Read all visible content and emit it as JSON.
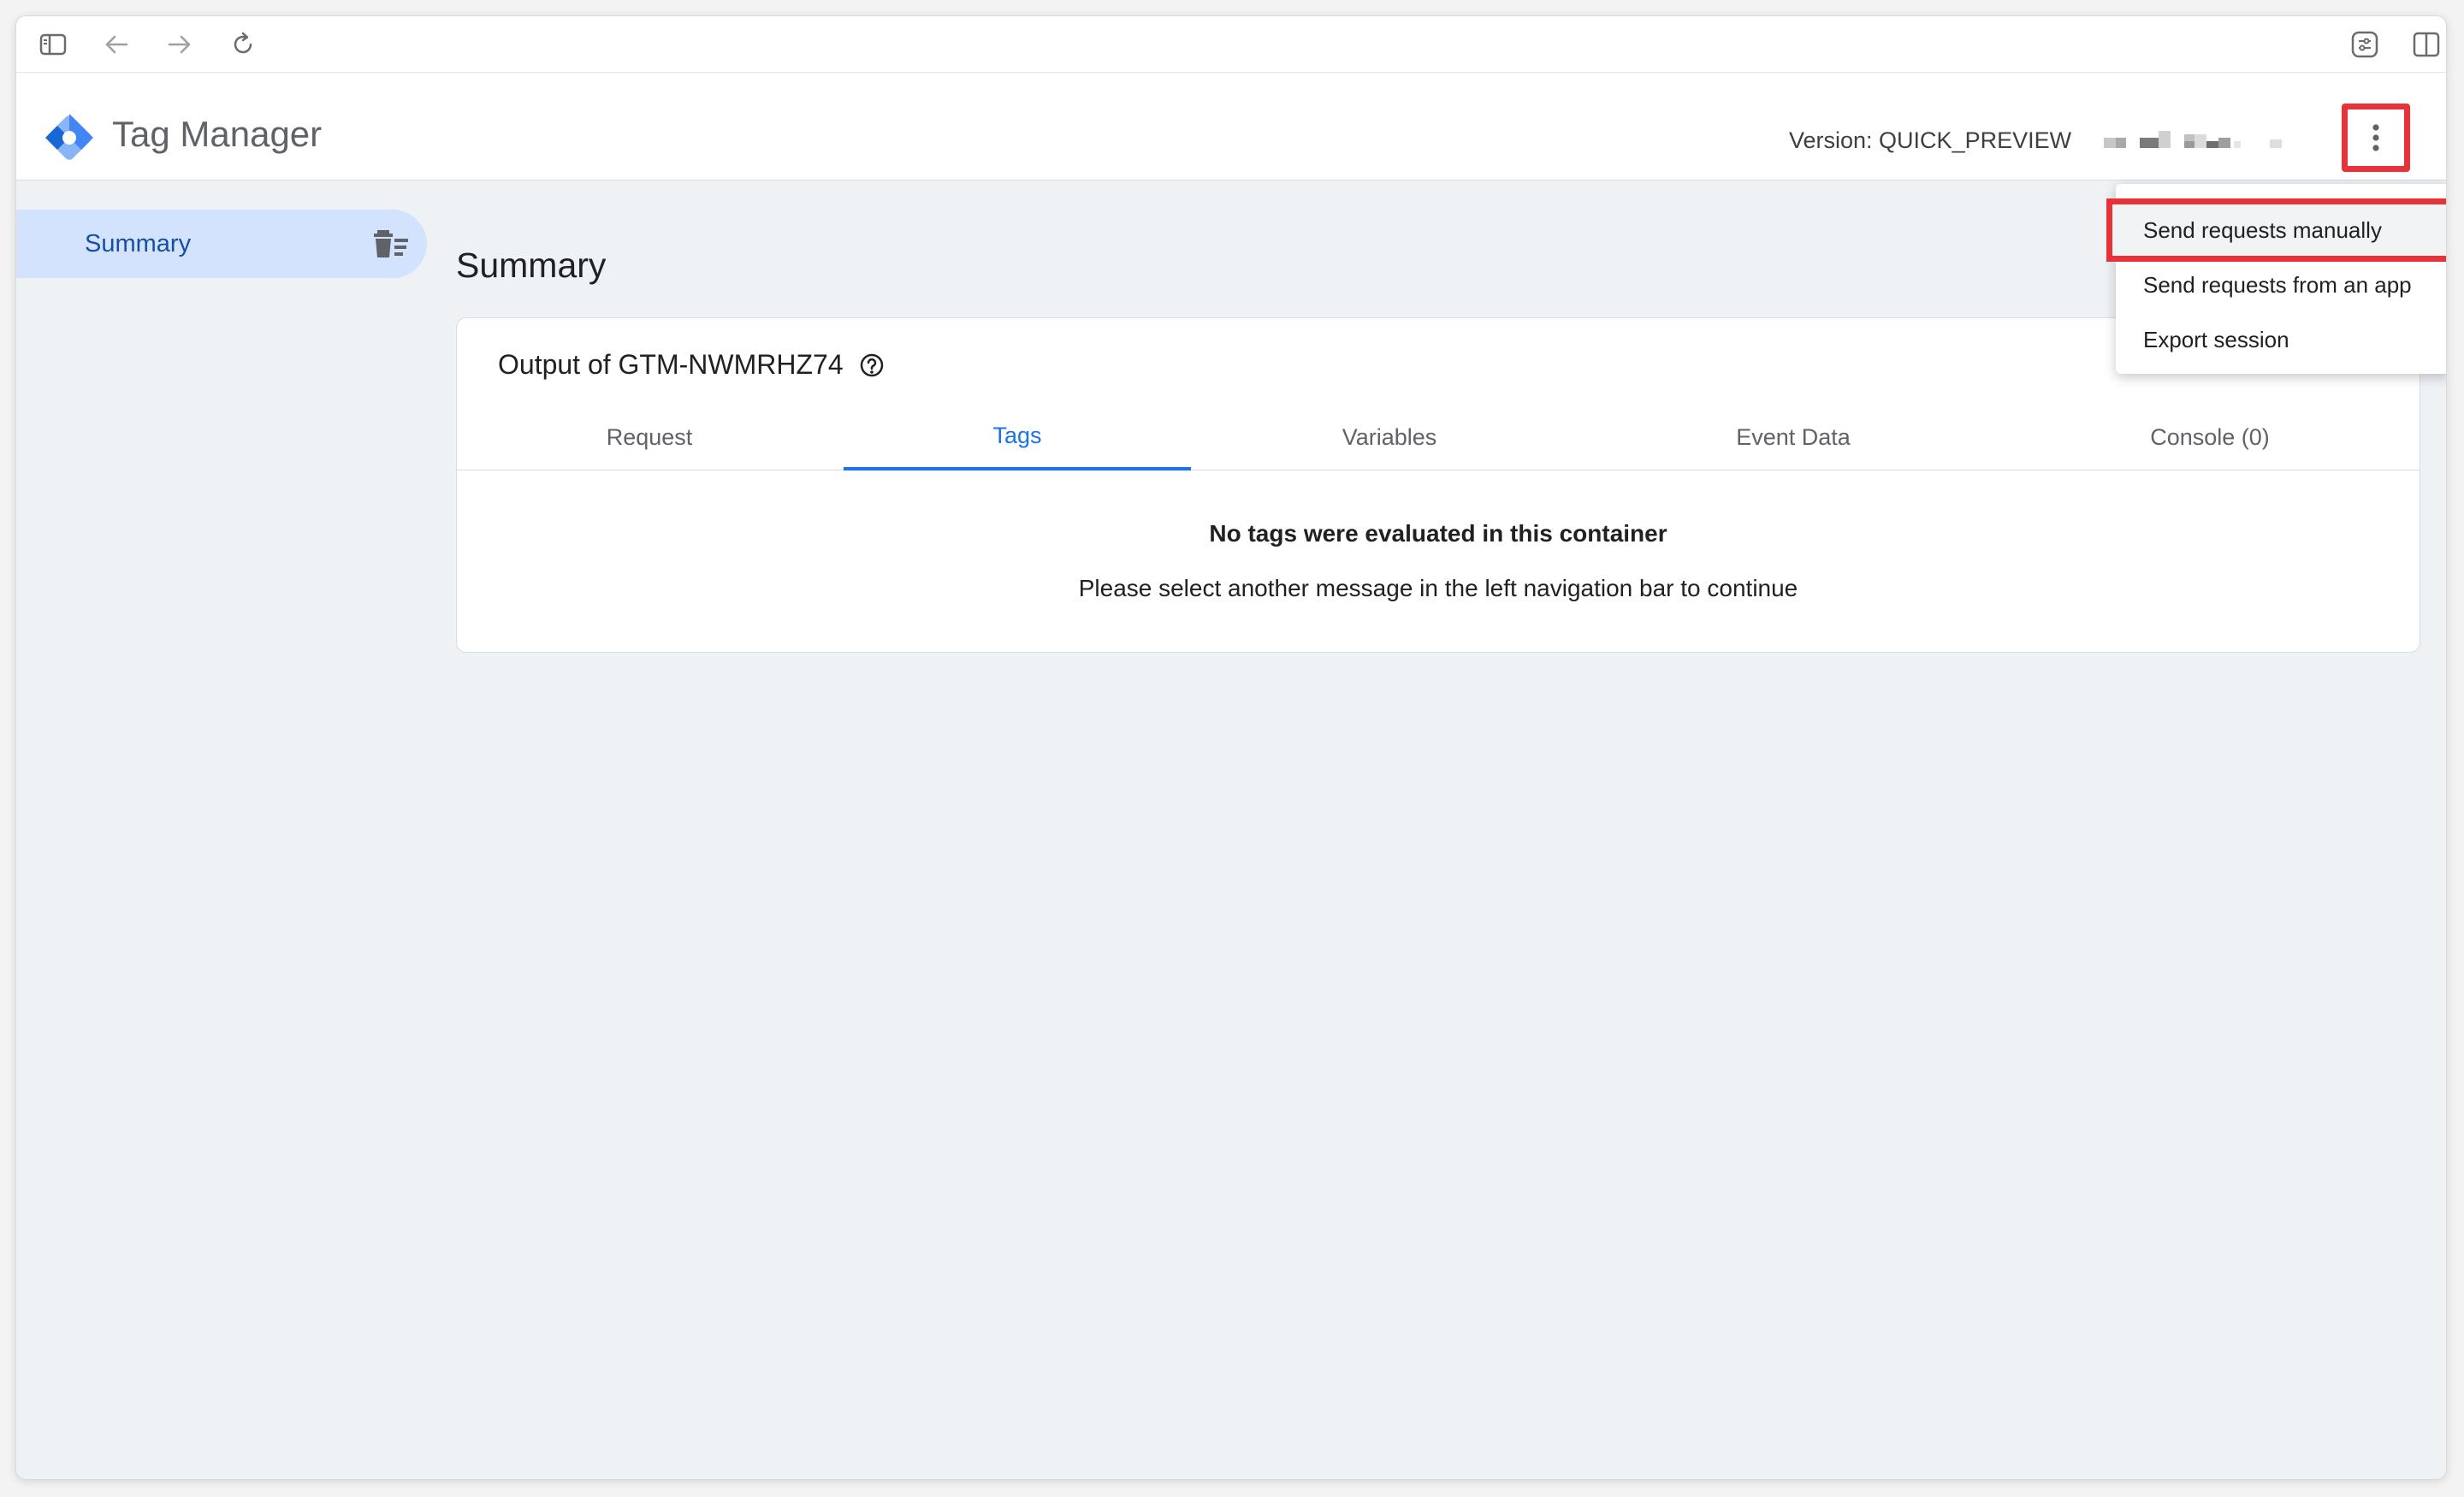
{
  "app": {
    "title": "Tag Manager",
    "version_label": "Version: QUICK_PREVIEW"
  },
  "sidebar": {
    "items": [
      {
        "label": "Summary",
        "icon": "clear-list-icon",
        "selected": true
      }
    ]
  },
  "main": {
    "title": "Summary",
    "card": {
      "title": "Output of GTM-NWMRHZ74",
      "tabs": [
        {
          "label": "Request"
        },
        {
          "label": "Tags",
          "active": true
        },
        {
          "label": "Variables"
        },
        {
          "label": "Event Data"
        },
        {
          "label": "Console (0)"
        }
      ],
      "empty_title": "No tags were evaluated in this container",
      "empty_message": "Please select another message in the left navigation bar to continue"
    }
  },
  "menu": {
    "items": [
      {
        "label": "Send requests manually",
        "highlighted": true
      },
      {
        "label": "Send requests from an app"
      },
      {
        "label": "Export session"
      }
    ]
  },
  "colors": {
    "accent": "#1a73e8",
    "highlight_border": "#e8323a",
    "sidebar_selected": "#d3e3fd"
  }
}
